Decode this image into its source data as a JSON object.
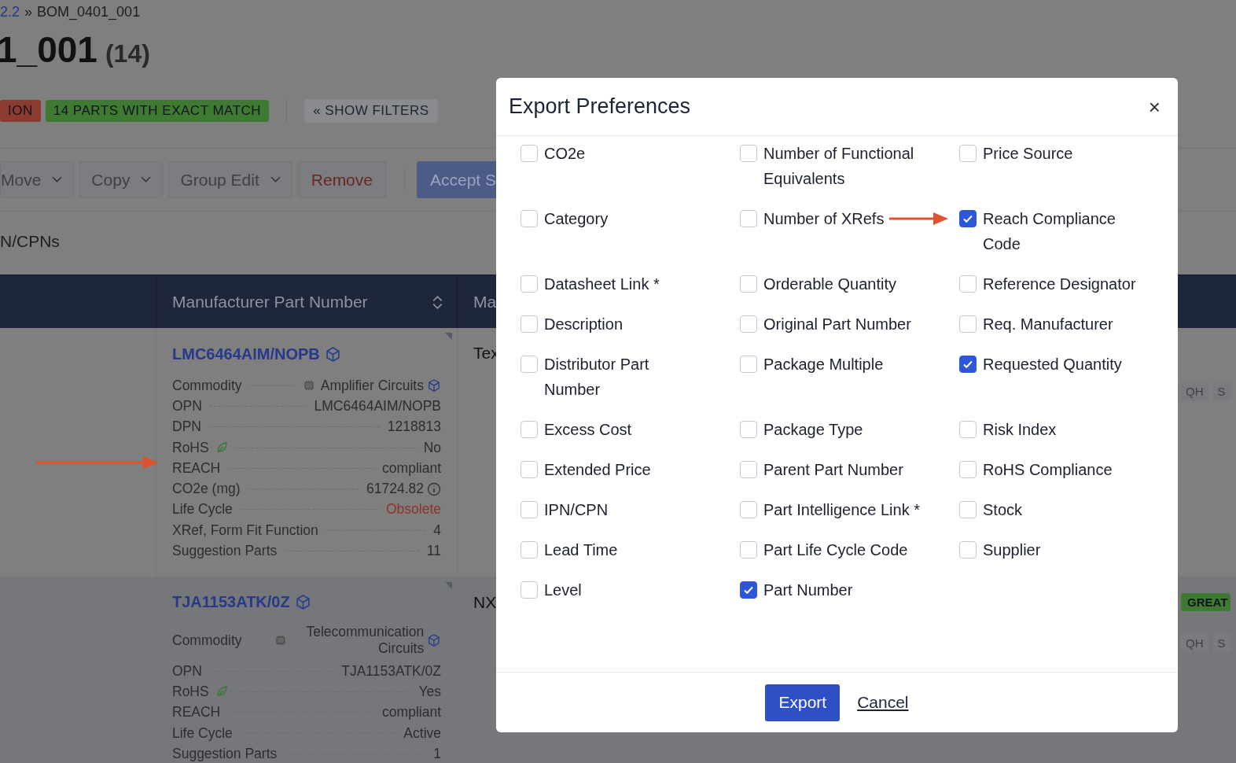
{
  "breadcrumb": {
    "link": "2.2",
    "separator": "»",
    "current": "BOM_0401_001"
  },
  "title": {
    "name": "1_001",
    "count": "(14)"
  },
  "badges": [
    {
      "label": "ION",
      "color": "#8c3b31"
    },
    {
      "label": "14 PARTS WITH EXACT MATCH",
      "color": "#3f7a33"
    }
  ],
  "show_filters": "« SHOW FILTERS",
  "toolbar": [
    {
      "label": "Move",
      "kind": "dropdown"
    },
    {
      "label": "Copy",
      "kind": "dropdown"
    },
    {
      "label": "Group Edit",
      "kind": "dropdown"
    },
    {
      "label": "Remove",
      "kind": "danger"
    },
    {
      "label": "Accept S",
      "kind": "primary"
    }
  ],
  "section_title": "N/CPNs",
  "table": {
    "columns": [
      {
        "label": "Manufacturer Part Number",
        "sortable": true
      },
      {
        "label": "Ma"
      }
    ],
    "rows": [
      {
        "part": "LMC6464AIM/NOPB",
        "column_3": "Tex",
        "tags": [
          {
            "label": "QH",
            "kind": "chip"
          },
          {
            "label": "S",
            "kind": "chip"
          }
        ],
        "fields": [
          {
            "label": "Commodity",
            "value": "Amplifier Circuits",
            "kind": "commodity"
          },
          {
            "label": "OPN",
            "value": "LMC6464AIM/NOPB",
            "kind": "text"
          },
          {
            "label": "DPN",
            "value": "1218813",
            "kind": "text"
          },
          {
            "label": "RoHS",
            "value": "No",
            "kind": "rohs"
          },
          {
            "label": "REACH",
            "value": "compliant",
            "kind": "text"
          },
          {
            "label": "CO2e (mg)",
            "value": "61724.82",
            "kind": "co2"
          },
          {
            "label": "Life Cycle",
            "value": "Obsolete",
            "kind": "lifecycle",
            "alert": true
          },
          {
            "label": "XRef, Form Fit Function",
            "value": "4",
            "kind": "text"
          },
          {
            "label": "Suggestion Parts",
            "value": "11",
            "kind": "text"
          }
        ]
      },
      {
        "part": "TJA1153ATK/0Z",
        "column_3": "NX",
        "tags": [
          {
            "label": "GREAT",
            "kind": "badge"
          },
          {
            "label": "QH",
            "kind": "chip"
          },
          {
            "label": "S",
            "kind": "chip"
          }
        ],
        "fields": [
          {
            "label": "Commodity",
            "value": "Telecommunication Circuits",
            "kind": "commodity"
          },
          {
            "label": "OPN",
            "value": "TJA1153ATK/0Z",
            "kind": "text"
          },
          {
            "label": "RoHS",
            "value": "Yes",
            "kind": "rohs"
          },
          {
            "label": "REACH",
            "value": "compliant",
            "kind": "text"
          },
          {
            "label": "Life Cycle",
            "value": "Active",
            "kind": "lifecycle",
            "alert": false
          },
          {
            "label": "Suggestion Parts",
            "value": "1",
            "kind": "text"
          }
        ]
      }
    ]
  },
  "dialog": {
    "title": "Export Preferences",
    "close": "×",
    "options": [
      {
        "label": "CO2e",
        "checked": false
      },
      {
        "label": "Number of Functional Equivalents",
        "checked": false
      },
      {
        "label": "Price Source",
        "checked": false
      },
      {
        "label": "Category",
        "checked": false
      },
      {
        "label": "Number of XRefs",
        "checked": false
      },
      {
        "label": "Reach Compliance Code",
        "checked": true
      },
      {
        "label": "Datasheet Link *",
        "checked": false
      },
      {
        "label": "Orderable Quantity",
        "checked": false
      },
      {
        "label": "Reference Designator",
        "checked": false
      },
      {
        "label": "Description",
        "checked": false
      },
      {
        "label": "Original Part Number",
        "checked": false
      },
      {
        "label": "Req. Manufacturer",
        "checked": false
      },
      {
        "label": "Distributor Part Number",
        "checked": false
      },
      {
        "label": "Package Multiple",
        "checked": false
      },
      {
        "label": "Requested Quantity",
        "checked": true
      },
      {
        "label": "Excess Cost",
        "checked": false
      },
      {
        "label": "Package Type",
        "checked": false
      },
      {
        "label": "Risk Index",
        "checked": false
      },
      {
        "label": "Extended Price",
        "checked": false
      },
      {
        "label": "Parent Part Number",
        "checked": false
      },
      {
        "label": "RoHS Compliance",
        "checked": false
      },
      {
        "label": "IPN/CPN",
        "checked": false
      },
      {
        "label": "Part Intelligence Link *",
        "checked": false
      },
      {
        "label": "Stock",
        "checked": false
      },
      {
        "label": "Lead Time",
        "checked": false
      },
      {
        "label": "Part Life Cycle Code",
        "checked": false
      },
      {
        "label": "Supplier",
        "checked": false
      },
      {
        "label": "Level",
        "checked": false
      },
      {
        "label": "Part Number",
        "checked": true
      }
    ],
    "buttons": [
      {
        "label": "Export",
        "kind": "primary"
      },
      {
        "label": "Cancel",
        "kind": "link"
      }
    ]
  }
}
